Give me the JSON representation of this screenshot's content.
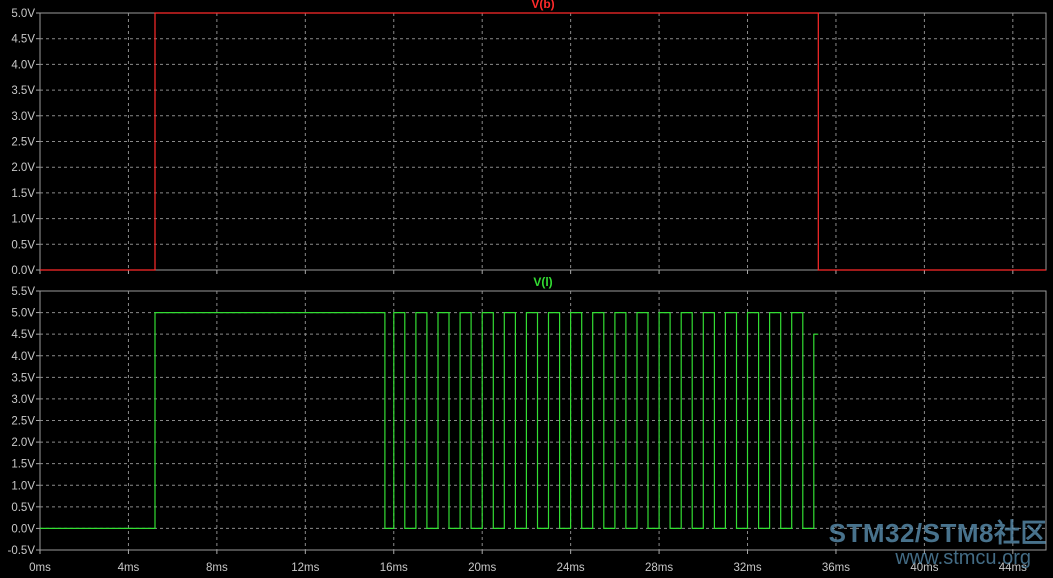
{
  "chart_data": [
    {
      "type": "line",
      "title": "V(b)",
      "xlabel": "",
      "ylabel": "",
      "xlim": [
        0,
        45.5
      ],
      "ylim": [
        0,
        5.0
      ],
      "x_ticks": [
        "0ms",
        "4ms",
        "8ms",
        "12ms",
        "16ms",
        "20ms",
        "24ms",
        "28ms",
        "32ms",
        "36ms",
        "40ms",
        "44ms"
      ],
      "y_ticks": [
        "0.0V",
        "0.5V",
        "1.0V",
        "1.5V",
        "2.0V",
        "2.5V",
        "3.0V",
        "3.5V",
        "4.0V",
        "4.5V",
        "5.0V"
      ],
      "grid": true,
      "series": [
        {
          "name": "V(b)",
          "color": "#ff2a2a",
          "x": [
            0,
            5.2,
            5.2,
            35.2,
            35.2,
            45.5
          ],
          "y": [
            0,
            0,
            5,
            5,
            0,
            0
          ]
        }
      ]
    },
    {
      "type": "line",
      "title": "V(l)",
      "xlabel": "",
      "ylabel": "",
      "xlim": [
        0,
        45.5
      ],
      "ylim": [
        -0.5,
        5.5
      ],
      "x_ticks": [
        "0ms",
        "4ms",
        "8ms",
        "12ms",
        "16ms",
        "20ms",
        "24ms",
        "28ms",
        "32ms",
        "36ms",
        "40ms",
        "44ms"
      ],
      "y_ticks": [
        "-0.5V",
        "0.0V",
        "0.5V",
        "1.0V",
        "1.5V",
        "2.0V",
        "2.5V",
        "3.0V",
        "3.5V",
        "4.0V",
        "4.5V",
        "5.0V",
        "5.5V"
      ],
      "grid": true,
      "series": [
        {
          "name": "V(l)",
          "color": "#33dd33",
          "x": [
            0,
            5.2,
            5.2,
            15.6,
            15.6,
            16.0,
            16.0,
            16.5,
            16.5,
            17.0,
            17.0,
            17.5,
            17.5,
            18.0,
            18.0,
            18.5,
            18.5,
            19.0,
            19.0,
            19.5,
            19.5,
            20.0,
            20.0,
            20.5,
            20.5,
            21.0,
            21.0,
            21.5,
            21.5,
            22.0,
            22.0,
            22.5,
            22.5,
            23.0,
            23.0,
            23.5,
            23.5,
            24.0,
            24.0,
            24.5,
            24.5,
            25.0,
            25.0,
            25.5,
            25.5,
            26.0,
            26.0,
            26.5,
            26.5,
            27.0,
            27.0,
            27.5,
            27.5,
            28.0,
            28.0,
            28.5,
            28.5,
            29.0,
            29.0,
            29.5,
            29.5,
            30.0,
            30.0,
            30.5,
            30.5,
            31.0,
            31.0,
            31.5,
            31.5,
            32.0,
            32.0,
            32.5,
            32.5,
            33.0,
            33.0,
            33.5,
            33.5,
            34.0,
            34.0,
            34.5,
            34.5,
            35.0,
            35.0,
            35.2
          ],
          "y": [
            0,
            0,
            5,
            5,
            0,
            0,
            5,
            5,
            0,
            0,
            5,
            5,
            0,
            0,
            5,
            5,
            0,
            0,
            5,
            5,
            0,
            0,
            5,
            5,
            0,
            0,
            5,
            5,
            0,
            0,
            5,
            5,
            0,
            0,
            5,
            5,
            0,
            0,
            5,
            5,
            0,
            0,
            5,
            5,
            0,
            0,
            5,
            5,
            0,
            0,
            5,
            5,
            0,
            0,
            5,
            5,
            0,
            0,
            5,
            5,
            0,
            0,
            5,
            5,
            0,
            0,
            5,
            5,
            0,
            0,
            5,
            5,
            0,
            0,
            5,
            5,
            0,
            0,
            5,
            5,
            0,
            0,
            4.5,
            4.5
          ]
        }
      ]
    }
  ],
  "watermark": {
    "line1": "STM32/STM8社区",
    "line2": "www.stmcu.org"
  }
}
